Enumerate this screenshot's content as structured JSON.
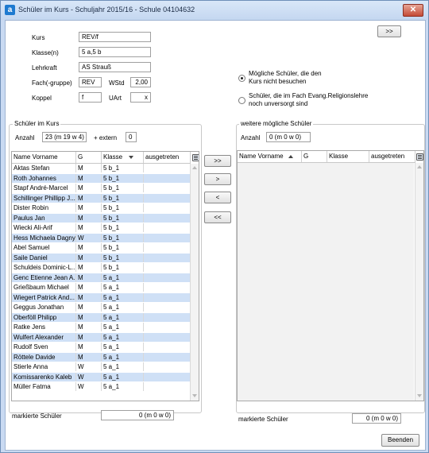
{
  "window": {
    "title": "Schüler im Kurs - Schuljahr 2015/16 - Schule 04104632",
    "app_icon": "a",
    "close_glyph": "✕"
  },
  "kurs": {
    "kurs_label": "Kurs",
    "kurs_value": "REV/f",
    "klassen_label": "Klasse(n)",
    "klassen_value": "5 a,5 b",
    "lehrkraft_label": "Lehrkraft",
    "lehrkraft_value": "AS Strauß",
    "fach_label": "Fach(-gruppe)",
    "fach_value": "REV",
    "wstd_label": "WStd",
    "wstd_value": "2,00",
    "koppel_label": "Koppel",
    "koppel_value": "f",
    "uart_label": "UArt",
    "uart_value": "x"
  },
  "top_button": ">>",
  "options": {
    "selected": 0,
    "items": [
      "Mögliche Schüler, die den Kurs nicht besuchen",
      "Schüler, die im Fach Evang.Religionslehre noch unversorgt sind"
    ]
  },
  "left": {
    "group_title": "Schüler im Kurs",
    "anzahl_label": "Anzahl",
    "anzahl_value": "23 (m 19 w 4)",
    "extern_label": "+ extern",
    "extern_value": "0",
    "columns": [
      "Name Vorname",
      "G",
      "Klasse",
      "ausgetreten"
    ],
    "rows": [
      [
        "Aktas Stefan",
        "M",
        "5 b_1",
        ""
      ],
      [
        "Roth Johannes",
        "M",
        "5 b_1",
        ""
      ],
      [
        "Stapf André-Marcel",
        "M",
        "5 b_1",
        ""
      ],
      [
        "Schillinger Phillipp J...",
        "M",
        "5 b_1",
        ""
      ],
      [
        "Dister Robin",
        "M",
        "5 b_1",
        ""
      ],
      [
        "Paulus Jan",
        "M",
        "5 b_1",
        ""
      ],
      [
        "Wiecki Ali-Arif",
        "M",
        "5 b_1",
        ""
      ],
      [
        "Hess Michaela Dagny",
        "W",
        "5 b_1",
        ""
      ],
      [
        "Abel Samuel",
        "M",
        "5 b_1",
        ""
      ],
      [
        "Saile Daniel",
        "M",
        "5 b_1",
        ""
      ],
      [
        "Schuldeis Dominic-L...",
        "M",
        "5 b_1",
        ""
      ],
      [
        "Genc Etienne Jean A...",
        "M",
        "5 a_1",
        ""
      ],
      [
        "Grießbaum Michael",
        "M",
        "5 a_1",
        ""
      ],
      [
        "Wiegert Patrick And...",
        "M",
        "5 a_1",
        ""
      ],
      [
        "Geggus Jonathan",
        "M",
        "5 a_1",
        ""
      ],
      [
        "Oberföll Philipp",
        "M",
        "5 a_1",
        ""
      ],
      [
        "Ratke Jens",
        "M",
        "5 a_1",
        ""
      ],
      [
        "Wulfert Alexander",
        "M",
        "5 a_1",
        ""
      ],
      [
        "Rudolf Sven",
        "M",
        "5 a_1",
        ""
      ],
      [
        "Röttele Davide",
        "M",
        "5 a_1",
        ""
      ],
      [
        "Stierle Anna",
        "W",
        "5 a_1",
        ""
      ],
      [
        "Komissarenko Kaleb",
        "W",
        "5 a_1",
        ""
      ],
      [
        "Müller Fatma",
        "W",
        "5 a_1",
        ""
      ]
    ],
    "markierte_label": "markierte Schüler",
    "markierte_value": "0 (m 0 w 0)"
  },
  "transfer": {
    "all_right": ">>",
    "one_right": ">",
    "one_left": "<",
    "all_left": "<<"
  },
  "right": {
    "group_title": "weitere mögliche Schüler",
    "anzahl_label": "Anzahl",
    "anzahl_value": "0 (m 0 w 0)",
    "columns": [
      "Name Vorname",
      "G",
      "Klasse",
      "ausgetreten"
    ],
    "markierte_label": "markierte Schüler",
    "markierte_value": "0 (m 0 w 0)"
  },
  "footer": {
    "close_label": "Beenden"
  }
}
